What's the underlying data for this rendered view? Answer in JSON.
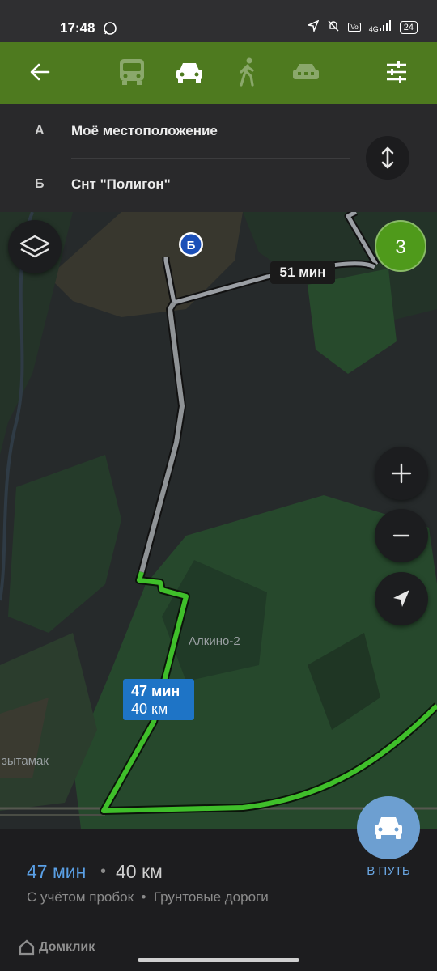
{
  "status": {
    "time": "17:48",
    "network": "4G",
    "battery": "24"
  },
  "toolbar": {
    "back_icon": "arrow-left-icon",
    "modes": [
      "bus-icon",
      "car-icon",
      "walk-icon",
      "taxi-icon"
    ],
    "settings_icon": "sliders-icon",
    "color": "#4e7a1f"
  },
  "route_points": {
    "a_letter": "А",
    "a_text": "Моё местоположение",
    "b_letter": "Б",
    "b_text": "Снт \"Полигон\""
  },
  "map": {
    "alt_route_label": "51 мин",
    "cluster_count": "3",
    "destination_marker": "Б",
    "place_label": "Алкино-2",
    "place_label_partial": "зытамак",
    "route_callout_time": "47 мин",
    "route_callout_dist": "40 км",
    "route_color": "#3fbf2a"
  },
  "bottom": {
    "time": "47 мин",
    "separator": "•",
    "distance": "40 км",
    "notes": "С учётом пробок  •  Грунтовые дороги",
    "go_label": "В ПУТЬ",
    "watermark": "Домклик",
    "accent": "#5aa0e6"
  }
}
